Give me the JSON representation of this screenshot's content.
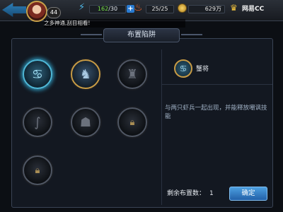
{
  "header": {
    "player_level": "44",
    "energy_current": "162",
    "energy_max": "/30",
    "stamina": "25/25",
    "coins": "629万",
    "brand": "网易CC"
  },
  "marquee": {
    "text": "之多神通,刮目相看!"
  },
  "panel": {
    "title": "布置陷阱"
  },
  "traps": [
    {
      "icon": "crab-icon",
      "state": "selected"
    },
    {
      "icon": "wolf-icon",
      "state": "owned"
    },
    {
      "icon": "boar-icon",
      "state": "normal"
    },
    {
      "icon": "snake-icon",
      "state": "normal"
    },
    {
      "icon": "ghost-icon",
      "state": "normal"
    },
    {
      "icon": "locked-icon",
      "state": "locked"
    },
    {
      "icon": "locked-icon",
      "state": "locked"
    }
  ],
  "detail": {
    "name": "蟹将",
    "description": "与两只虾兵一起出现，并能释放嘲讽技能"
  },
  "footer": {
    "remaining_label": "剩余布置数：",
    "remaining_value": "1",
    "confirm_label": "确定"
  },
  "colors": {
    "accent_blue": "#4fb7d6",
    "gold_border": "#c79b45",
    "confirm_blue": "#2260a8"
  }
}
